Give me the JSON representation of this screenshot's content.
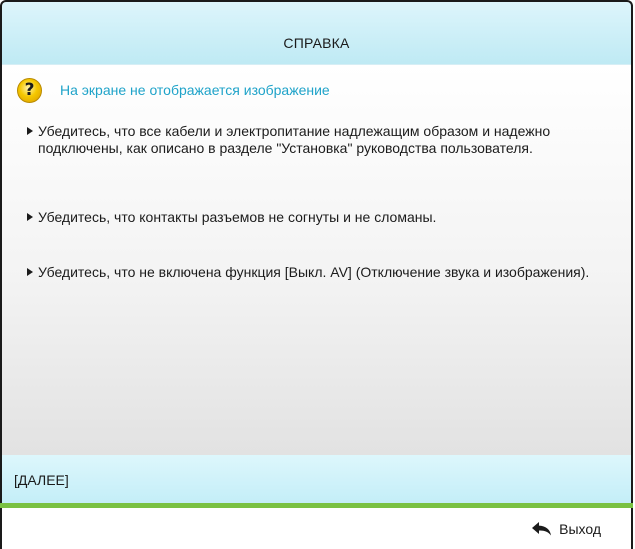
{
  "header": {
    "title": "СПРАВКА"
  },
  "topic": {
    "icon": "question-icon",
    "text": "На экране не отображается изображение",
    "text_color": "#1fa3c9"
  },
  "bullets": [
    {
      "text": "Убедитесь, что все кабели и электропитание надлежащим образом и надежно подключены, как описано в разделе \"Установка\" руководства пользователя."
    },
    {
      "text": "Убедитесь, что контакты разъемов не согнуты и не сломаны."
    },
    {
      "text": "Убедитесь, что не включена функция [Выкл. AV] (Отключение звука и изображения)."
    }
  ],
  "next": {
    "label": "[ДАЛЕЕ]"
  },
  "footer": {
    "exit_label": "Выход",
    "exit_icon": "return-arrow-icon"
  },
  "colors": {
    "accent_green": "#7ac142",
    "header_bg": "#c8edf6"
  }
}
